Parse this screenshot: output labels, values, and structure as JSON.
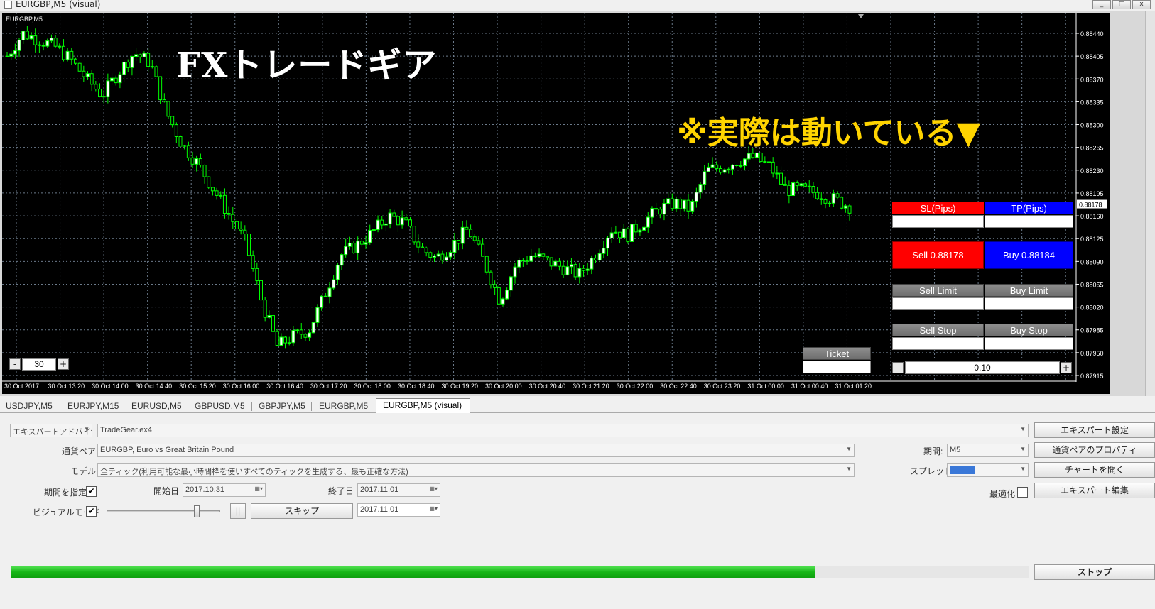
{
  "window": {
    "title": "EURGBP,M5 (visual)",
    "buttons": [
      "_",
      "□",
      "x"
    ]
  },
  "chart": {
    "symbol_label": "EURGBP,M5",
    "overlay_title": "FXトレードギア",
    "overlay_note": "※実際は動いている▼",
    "current_price": "0.88178",
    "price_labels": [
      "0.88440",
      "0.88405",
      "0.88370",
      "0.88335",
      "0.88300",
      "0.88265",
      "0.88230",
      "0.88195",
      "0.88160",
      "0.88125",
      "0.88090",
      "0.88055",
      "0.88020",
      "0.87985",
      "0.87950",
      "0.87915"
    ],
    "time_labels": [
      "30 Oct 2017",
      "30 Oct 13:20",
      "30 Oct 14:00",
      "30 Oct 14:40",
      "30 Oct 15:20",
      "30 Oct 16:00",
      "30 Oct 16:40",
      "30 Oct 17:20",
      "30 Oct 18:00",
      "30 Oct 18:40",
      "30 Oct 19:20",
      "30 Oct 20:00",
      "30 Oct 20:40",
      "30 Oct 21:20",
      "30 Oct 22:00",
      "30 Oct 22:40",
      "30 Oct 23:20",
      "31 Oct 00:00",
      "31 Oct 00:40",
      "31 Oct 01:20"
    ],
    "colors": {
      "bull": "#ffffff",
      "bear": "#000000",
      "wick": "#00ff00",
      "grid": "#6b7a8a",
      "bg": "#000000"
    },
    "close_path": [
      0.88405,
      0.8844,
      0.8843,
      0.8842,
      0.884,
      0.8837,
      0.88345,
      0.8838,
      0.8841,
      0.88395,
      0.8832,
      0.8827,
      0.8824,
      0.882,
      0.8816,
      0.8812,
      0.8803,
      0.8796,
      0.87975,
      0.87985,
      0.8804,
      0.881,
      0.88115,
      0.88135,
      0.8816,
      0.8815,
      0.8811,
      0.88095,
      0.88115,
      0.8814,
      0.8809,
      0.8803,
      0.88085,
      0.881,
      0.8809,
      0.8808,
      0.8807,
      0.881,
      0.8814,
      0.8813,
      0.8815,
      0.8817,
      0.8818,
      0.8817,
      0.8823,
      0.88235,
      0.88245,
      0.8825,
      0.88235,
      0.882,
      0.882,
      0.88195,
      0.88185,
      0.88175
    ]
  },
  "trade_panel": {
    "sl_label": "SL(Pips)",
    "tp_label": "TP(Pips)",
    "sell_label": "Sell 0.88178",
    "buy_label": "Buy 0.88184",
    "sell_limit_label": "Sell Limit",
    "buy_limit_label": "Buy Limit",
    "sell_stop_label": "Sell Stop",
    "buy_stop_label": "Buy Stop",
    "ticket_label": "Ticket",
    "lot_value": "0.10",
    "minus": "-",
    "plus": "+",
    "sl_color": "#ff0000",
    "tp_color": "#0000ff"
  },
  "zoom": {
    "value": "30",
    "minus": "-",
    "plus": "+"
  },
  "tabs": [
    "USDJPY,M5",
    "EURJPY,M15",
    "EURUSD,M5",
    "GBPUSD,M5",
    "GBPJPY,M5",
    "EURGBP,M5",
    "EURGBP,M5 (visual)"
  ],
  "tester": {
    "type_select": "エキスパートアドバイザ",
    "expert_select": "TradeGear.ex4",
    "symbol_label": "通貨ペア:",
    "symbol_select": "EURGBP, Euro vs Great Britain Pound",
    "model_label": "モデル:",
    "model_select": "全ティック(利用可能な最小時間枠を使いすべてのティックを生成する、最も正確な方法)",
    "period_label": "期間:",
    "period_select": "M5",
    "spread_label": "スプレッド:",
    "use_date_label": "期間を指定",
    "start_label": "開始日",
    "start_value": "2017.10.31",
    "end_label": "終了日",
    "end_value": "2017.11.01",
    "visual_label": "ビジュアルモード",
    "skip_label": "スキップ",
    "skip_to_value": "2017.11.01",
    "pause_label": "||",
    "optimize_label": "最適化",
    "checkmark": "✔",
    "btn_expert_props": "エキスパート設定",
    "btn_symbol_props": "通貨ペアのプロパティ",
    "btn_open_chart": "チャートを開く",
    "btn_edit_expert": "エキスパート編集",
    "btn_stop": "ストップ",
    "progress": 0.79,
    "progress_color": "#16b616"
  }
}
